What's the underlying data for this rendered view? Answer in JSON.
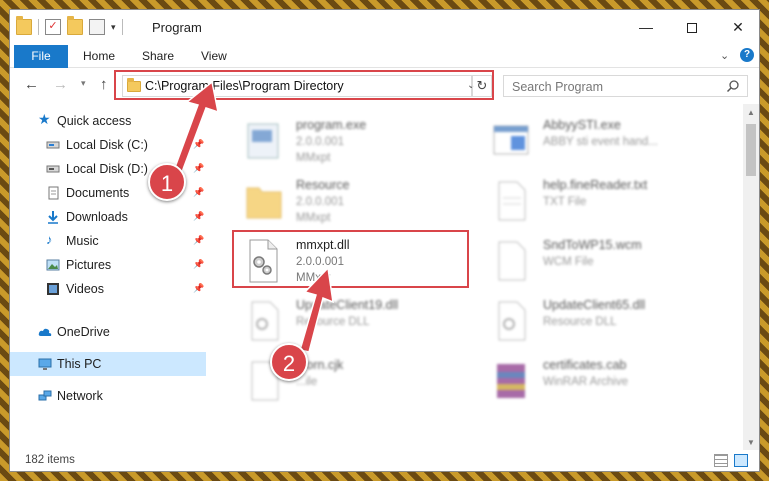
{
  "window": {
    "title": "Program",
    "minimize_glyph": "—",
    "close_glyph": "✕"
  },
  "ribbon": {
    "tabs": [
      {
        "label": "File"
      },
      {
        "label": "Home"
      },
      {
        "label": "Share"
      },
      {
        "label": "View"
      }
    ],
    "help_glyph": "?"
  },
  "navigation": {
    "address": "C:\\Program Files\\Program Directory",
    "search_placeholder": "Search Program"
  },
  "sidebar": {
    "items": [
      {
        "label": "Quick access",
        "icon": "star-icon"
      },
      {
        "label": "Local Disk (C:)",
        "icon": "drive-icon",
        "pinned": true
      },
      {
        "label": "Local Disk (D:)",
        "icon": "drive-icon",
        "pinned": true
      },
      {
        "label": "Documents",
        "icon": "documents-icon",
        "pinned": true
      },
      {
        "label": "Downloads",
        "icon": "downloads-icon",
        "pinned": true
      },
      {
        "label": "Music",
        "icon": "music-icon",
        "pinned": true
      },
      {
        "label": "Pictures",
        "icon": "pictures-icon",
        "pinned": true
      },
      {
        "label": "Videos",
        "icon": "videos-icon",
        "pinned": true
      },
      {
        "label": "OneDrive",
        "icon": "cloud-icon"
      },
      {
        "label": "This PC",
        "icon": "pc-icon",
        "selected": true
      },
      {
        "label": "Network",
        "icon": "network-icon"
      }
    ]
  },
  "files": [
    {
      "name": "program.exe",
      "line2": "2.0.0.001",
      "line3": "MMxpt",
      "icon": "exe-icon"
    },
    {
      "name": "AbbyySTI.exe",
      "line2": "ABBY sti event hand...",
      "line3": "",
      "icon": "window-icon"
    },
    {
      "name": "Resource",
      "line2": "2.0.0.001",
      "line3": "MMxpt",
      "icon": "folder-icon"
    },
    {
      "name": "help.fineReader.txt",
      "line2": "TXT File",
      "line3": "",
      "icon": "text-file-icon"
    },
    {
      "name": "mmxpt.dll",
      "line2": "2.0.0.001",
      "line3": "MMxpt",
      "icon": "dll-gear-icon"
    },
    {
      "name": "SndToWP15.wcm",
      "line2": "WCM File",
      "line3": "",
      "icon": "blank-file-icon"
    },
    {
      "name": "UpdateClient19.dll",
      "line2": "Resource DLL",
      "line3": "",
      "icon": "dll-gear-icon"
    },
    {
      "name": "UpdateClient65.dll",
      "line2": "Resource DLL",
      "line3": "",
      "icon": "dll-gear-icon"
    },
    {
      "name": "...orn.cjk",
      "line2": "...ile",
      "line3": "",
      "icon": "blank-file-icon"
    },
    {
      "name": "certificates.cab",
      "line2": "WinRAR Archive",
      "line3": "",
      "icon": "archive-icon"
    }
  ],
  "status": {
    "item_count": "182 items"
  },
  "callouts": [
    {
      "number": "1"
    },
    {
      "number": "2"
    }
  ],
  "colors": {
    "accent": "#1979ca",
    "highlight_red": "#d9454a",
    "selected_bg": "#cce8ff"
  }
}
